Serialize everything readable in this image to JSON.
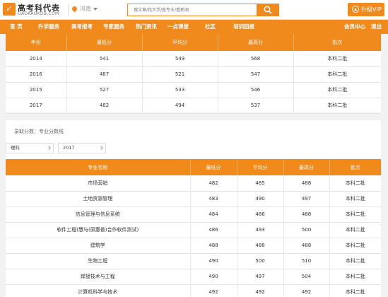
{
  "header": {
    "logo_mark": "✓",
    "logo_name": "高考科代表",
    "logo_sub": "GAOKAOKDB.COM",
    "location": "河南",
    "search_placeholder": "搜文章/找大学/查专业/看新闻",
    "upgrade_label": "升级VIP"
  },
  "nav": {
    "items": [
      "首 页",
      "升学服务",
      "高考报考",
      "专家服务",
      "热门资讯",
      "一点课堂",
      "社区",
      "培训团报",
      "会员中心",
      "退出"
    ]
  },
  "score_table": {
    "columns": [
      "年份",
      "最低分",
      "平均分",
      "最高分",
      "批次"
    ],
    "rows": [
      [
        "2014",
        "541",
        "549",
        "568",
        "本科二批"
      ],
      [
        "2016",
        "487",
        "521",
        "547",
        "本科二批"
      ],
      [
        "2015",
        "527",
        "533",
        "546",
        "本科二批"
      ],
      [
        "2017",
        "482",
        "494",
        "537",
        "本科二批"
      ]
    ]
  },
  "major_section": {
    "label": "录取分数：专业分数线",
    "filter_subject": "理科",
    "filter_year": "2017",
    "columns": [
      "专业名称",
      "最低分",
      "平均分",
      "最高分",
      "批次"
    ],
    "rows": [
      [
        "市场营销",
        "482",
        "485",
        "488",
        "本科二批"
      ],
      [
        "土地资源管理",
        "483",
        "490",
        "497",
        "本科二批"
      ],
      [
        "信息管理与信息系统",
        "484",
        "486",
        "488",
        "本科二批"
      ],
      [
        "软件工程(慧与(原惠普)合作软件测试)",
        "486",
        "493",
        "500",
        "本科二批"
      ],
      [
        "建筑学",
        "488",
        "488",
        "488",
        "本科二批"
      ],
      [
        "生物工程",
        "490",
        "500",
        "510",
        "本科二批"
      ],
      [
        "焊接技术与工程",
        "490",
        "497",
        "504",
        "本科二批"
      ],
      [
        "计算机科学与技术",
        "492",
        "492",
        "492",
        "本科二批"
      ]
    ]
  },
  "colors": {
    "accent": "#f08a1c",
    "background": "#f2f2f2"
  }
}
